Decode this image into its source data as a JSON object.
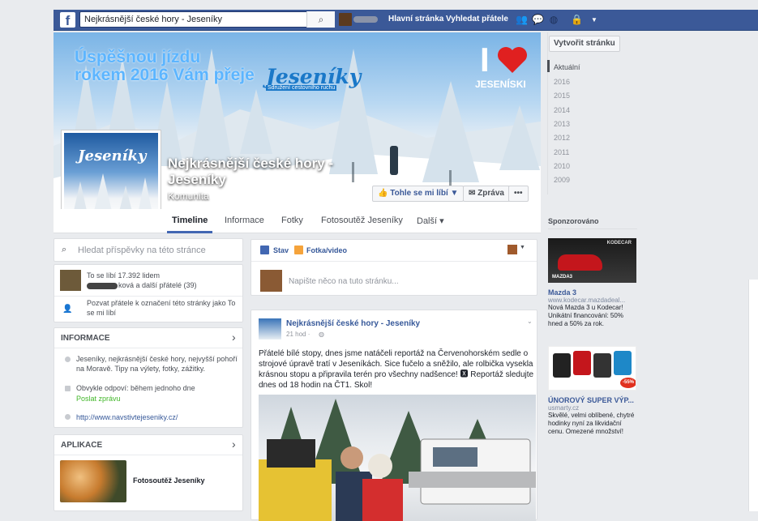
{
  "topbar": {
    "search_value": "Nejkrásnější české hory - Jeseníky",
    "links": [
      "Hlavní stránka",
      "Vyhledat přátele"
    ],
    "logo": "f"
  },
  "cover": {
    "greeting_line1": "Úspěšnou jízdu",
    "greeting_line2": "rokem 2016 Vám přeje",
    "logo_text": "Jeseníky",
    "logo_sub": "Sdružení cestovního ruchu",
    "heart_label": "JESENÍSKI",
    "heart_letter": "I"
  },
  "profile": {
    "logo_text": "Jeseníky",
    "title": "Nejkrásnější české hory - Jeseníky",
    "category": "Komunita"
  },
  "cover_buttons": {
    "like": "👍 Tohle se mi líbí ▼",
    "message": "✉ Zpráva",
    "more": "•••"
  },
  "tabs": [
    "Timeline",
    "Informace",
    "Fotky",
    "Fotosoutěž Jeseníky",
    "Další ▾"
  ],
  "sidebar": {
    "create_page": "Vytvořit stránku",
    "years": [
      "Aktuální",
      "2016",
      "2015",
      "2014",
      "2013",
      "2012",
      "2011",
      "2010",
      "2009"
    ]
  },
  "left": {
    "search_placeholder": "Hledat příspěvky na této stránce",
    "likes": "To se líbí 17.392 lidem",
    "friends_suffix": "ková a další přátelé (39)",
    "invite": "Pozvat přátele k označení této stránky jako To se mi líbí",
    "info_header": "INFORMACE",
    "info_desc": "Jeseníky, nejkrásnější české hory, nejvyšší pohoří na Moravě. Tipy na výlety, fotky, zážitky.",
    "response": "Obvykle odpoví: během jednoho dne",
    "send_message": "Poslat zprávu",
    "website": "http://www.navstivtejeseniky.cz/",
    "apps_header": "APLIKACE",
    "app_name": "Fotosoutěž Jeseníky",
    "chevron": "›"
  },
  "composer": {
    "status": "Stav",
    "photo": "Fotka/video",
    "placeholder": "Napište něco na tuto stránku..."
  },
  "post": {
    "author": "Nejkrásnější české hory - Jeseníky",
    "time": "21 hod · ",
    "text": "Přátelé bílé stopy, dnes jsme natáčeli reportáž na Červenohorském sedle o strojové úpravě tratí v Jeseníkách. Sice fučelo a sněžilo, ale rolbička vysekla krásnou stopu a připravila terén pro všechny nadšence! 🆇 Reportáž sledujte dnes od 18 hodin na ČT1. Skol!"
  },
  "ads": {
    "header": "Sponzorováno",
    "ad1_title": "Mazda 3",
    "ad1_url": "www.kodecar.mazdadeal...",
    "ad1_text": "Nová Mazda 3 u Kodecar! Unikátní financování: 50% hned a 50% za rok.",
    "ad1_banner": "KODECAR",
    "ad1_model": "MAZDA3",
    "ad2_title": "ÚNOROVÝ SUPER VÝP...",
    "ad2_url": "usmarty.cz",
    "ad2_text": "Skvělé, velmi oblíbené, chytré hodinky nyní za likvidační cenu. Omezené množství!",
    "ad2_badge": "-55%"
  }
}
